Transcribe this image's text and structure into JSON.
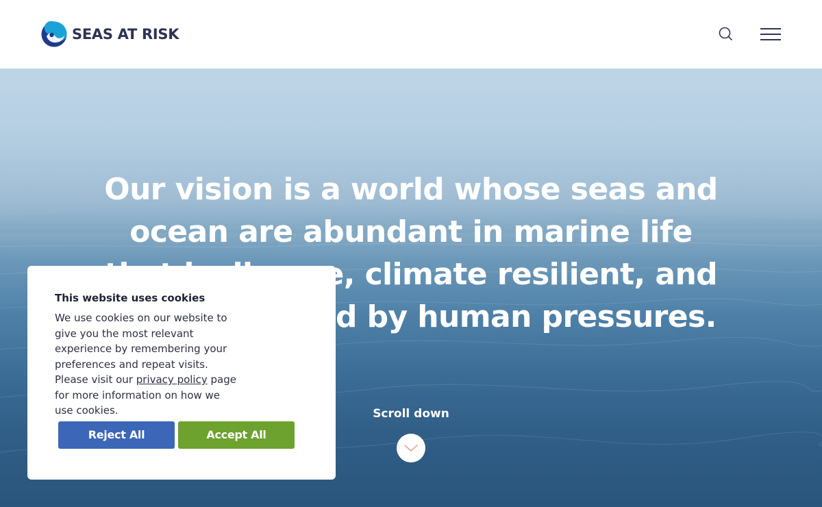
{
  "brand": {
    "name": "SEAS AT RISK",
    "text_color": "#2c3354",
    "accent_color": "#1aa3d9"
  },
  "header": {
    "search_icon": "search-icon",
    "menu_icon": "hamburger-menu-icon"
  },
  "hero": {
    "title": "Our vision is a world whose seas and ocean are abundant in marine life that is diverse, climate resilient, and not threatened by human pressures.",
    "scroll_label": "Scroll down",
    "scroll_icon": "chevron-down-icon"
  },
  "cookie_banner": {
    "title": "This website uses cookies",
    "text_before_link": "We use cookies on our website to give you the most relevant experience by remembering your preferences and repeat visits. Please visit our ",
    "link_label": "privacy policy",
    "text_after_link": " page for more information on how we use cookies.",
    "reject_label": "Reject All",
    "accept_label": "Accept All",
    "reject_color": "#3c66b8",
    "accept_color": "#6ca22d"
  }
}
